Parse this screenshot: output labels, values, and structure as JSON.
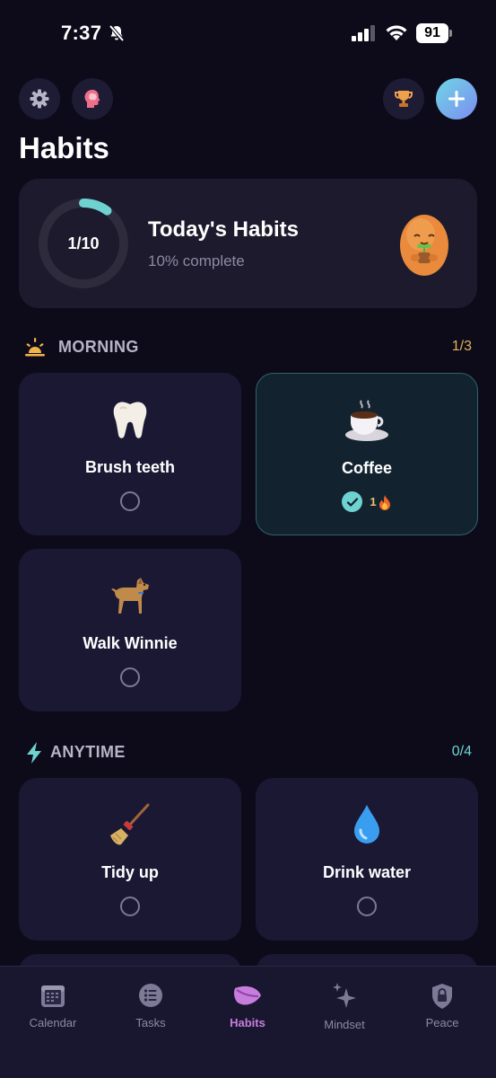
{
  "status": {
    "time": "7:37",
    "battery": "91"
  },
  "header": {
    "title": "Habits"
  },
  "today": {
    "title": "Today's Habits",
    "progress_label": "1/10",
    "subtitle": "10% complete",
    "progress": 0.1
  },
  "sections": [
    {
      "label": "MORNING",
      "count": "1/3",
      "count_color": "#e2b35a",
      "icon": "sunrise-icon",
      "habits": [
        {
          "name": "Brush teeth",
          "emoji": "tooth-icon",
          "done": false
        },
        {
          "name": "Coffee",
          "emoji": "coffee-icon",
          "done": true,
          "streak": "1"
        },
        {
          "name": "Walk Winnie",
          "emoji": "dog-icon",
          "done": false
        }
      ]
    },
    {
      "label": "ANYTIME",
      "count": "0/4",
      "count_color": "#6ed3d0",
      "icon": "lightning-icon",
      "habits": [
        {
          "name": "Tidy up",
          "emoji": "broom-icon",
          "done": false
        },
        {
          "name": "Drink water",
          "emoji": "droplet-icon",
          "done": false
        }
      ]
    }
  ],
  "tabs": [
    {
      "label": "Calendar",
      "icon": "calendar-icon",
      "active": false
    },
    {
      "label": "Tasks",
      "icon": "list-icon",
      "active": false
    },
    {
      "label": "Habits",
      "icon": "leaf-icon",
      "active": true
    },
    {
      "label": "Mindset",
      "icon": "sparkles-icon",
      "active": false
    },
    {
      "label": "Peace",
      "icon": "lock-icon",
      "active": false
    }
  ],
  "colors": {
    "accent": "#6ed3d0",
    "active_tab": "#c77ddc",
    "background": "#0d0b1a"
  }
}
